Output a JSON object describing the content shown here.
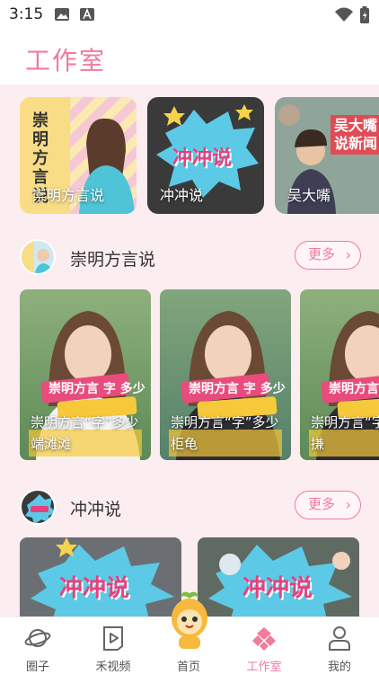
{
  "status_bar": {
    "time": "3:15"
  },
  "header": {
    "title": "工作室"
  },
  "top_cards": [
    {
      "label": "崇明方言说",
      "poster_text": "崇明方言说"
    },
    {
      "label": "冲冲说",
      "poster_text": "冲冲说"
    },
    {
      "label": "吴大嘴",
      "poster_text": "吴大嘴 说新闻"
    }
  ],
  "sections": [
    {
      "name": "崇明方言说",
      "more_label": "更多",
      "videos": [
        {
          "title": "崇明方言“字”多少 端滩滩",
          "overlay": "崇明方言 字 多少"
        },
        {
          "title": "崇明方言“字”多少 柜龟",
          "overlay": "崇明方言 字 多少"
        },
        {
          "title": "崇明方言“字”多少 搛",
          "overlay": "崇明方言 字 多少"
        }
      ]
    },
    {
      "name": "冲冲说",
      "more_label": "更多",
      "videos": [
        {
          "title": "",
          "overlay": "冲冲说"
        },
        {
          "title": "",
          "overlay": "冲冲说"
        }
      ]
    }
  ],
  "tab_bar": {
    "items": [
      {
        "label": "圈子",
        "icon": "planet-icon"
      },
      {
        "label": "禾视频",
        "icon": "play-icon"
      },
      {
        "label": "首页",
        "icon": "mascot-icon"
      },
      {
        "label": "工作室",
        "icon": "studio-icon"
      },
      {
        "label": "我的",
        "icon": "person-icon"
      }
    ],
    "active": "工作室"
  },
  "colors": {
    "accent": "#f27a9c",
    "background": "#fcedf1"
  }
}
